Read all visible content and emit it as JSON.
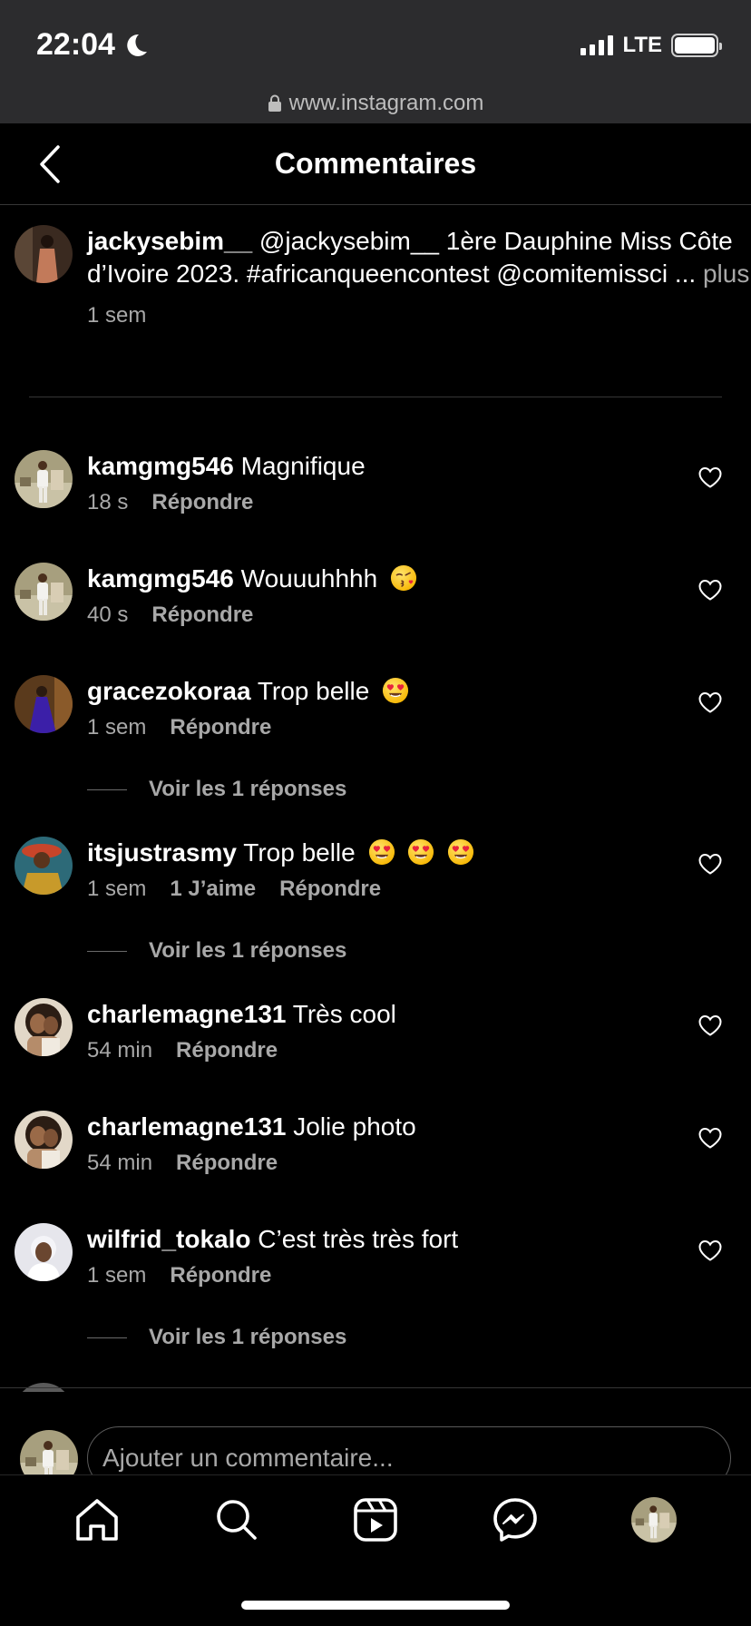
{
  "status_bar": {
    "time": "22:04",
    "network": "LTE"
  },
  "browser": {
    "url": "www.instagram.com"
  },
  "header": {
    "title": "Commentaires"
  },
  "caption": {
    "username": "jackysebim__",
    "text": "@jackysebim__ 1ère Dauphine Miss Côte d’Ivoire 2023. #africanqueencontest @comitemissci ...",
    "more": "plus",
    "time": "1 sem"
  },
  "comments": [
    {
      "username": "kamgmg546",
      "text": "Magnifique",
      "time": "18 s",
      "likes": "",
      "reply": "Répondre",
      "emojis": [],
      "replies_link": ""
    },
    {
      "username": "kamgmg546",
      "text": "Wouuuhhhh",
      "time": "40 s",
      "likes": "",
      "reply": "Répondre",
      "emojis": [
        "face-blowing-kiss"
      ],
      "replies_link": ""
    },
    {
      "username": "gracezokoraa",
      "text": "Trop belle",
      "time": "1 sem",
      "likes": "",
      "reply": "Répondre",
      "emojis": [
        "heart-eyes"
      ],
      "replies_link": "Voir les 1 réponses"
    },
    {
      "username": "itsjustrasmy",
      "text": "Trop belle",
      "time": "1 sem",
      "likes": "1 J’aime",
      "reply": "Répondre",
      "emojis": [
        "heart-eyes",
        "heart-eyes",
        "heart-eyes"
      ],
      "replies_link": "Voir les 1 réponses"
    },
    {
      "username": "charlemagne131",
      "text": "Très cool",
      "time": "54 min",
      "likes": "",
      "reply": "Répondre",
      "emojis": [],
      "replies_link": ""
    },
    {
      "username": "charlemagne131",
      "text": "Jolie photo",
      "time": "54 min",
      "likes": "",
      "reply": "Répondre",
      "emojis": [],
      "replies_link": ""
    },
    {
      "username": "wilfrid_tokalo",
      "text": "C’est très très fort",
      "time": "1 sem",
      "likes": "",
      "reply": "Répondre",
      "emojis": [],
      "replies_link": "Voir les 1 réponses"
    }
  ],
  "composer": {
    "placeholder": "Ajouter un commentaire..."
  },
  "tabbar": {
    "icons": [
      "home-icon",
      "search-icon",
      "reels-icon",
      "messenger-icon",
      "profile-avatar"
    ]
  },
  "colors": {
    "background": "#000000",
    "chrome": "#2c2c2e",
    "secondary_text": "#a8a8a8",
    "divider": "#363636"
  }
}
